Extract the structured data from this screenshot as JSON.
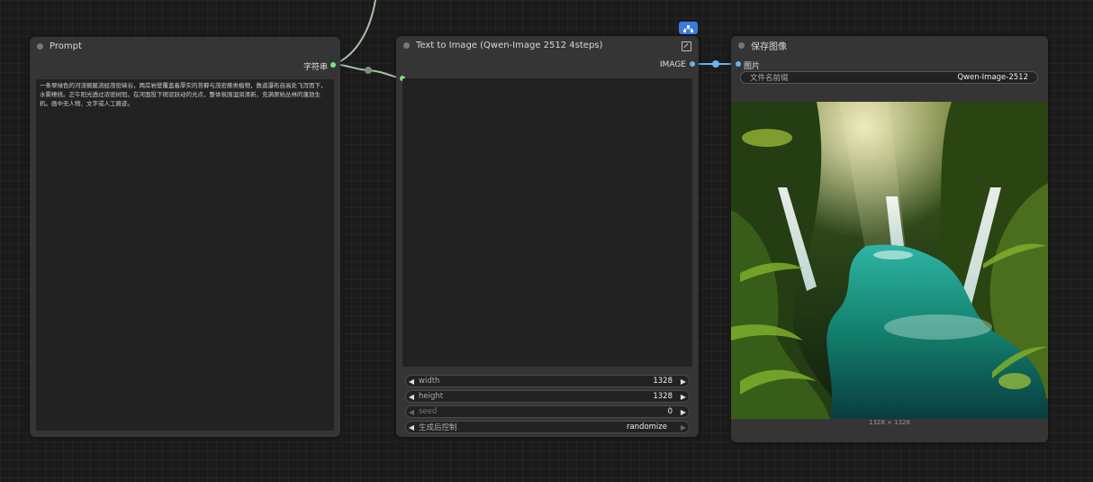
{
  "nodes": {
    "prompt": {
      "title": "Prompt",
      "output_label": "字符串",
      "text": "一条翠绿色的河流蜿蜒流经茂密峡谷，两岸岩壁覆盖着厚实的苔藓与茂密蕨类植物，数道瀑布自高处飞泻而下，水雾缭绕。正午阳光透过浓密树冠，在河面投下斑驳跃动的光点，整体氛围湿润清新，充满原始丛林的蓬勃生机。画中无人物、文字或人工痕迹。"
    },
    "t2i": {
      "title": "Text to Image (Qwen-Image 2512 4steps)",
      "output_label": "IMAGE",
      "widgets": [
        {
          "name": "width",
          "value": "1328"
        },
        {
          "name": "height",
          "value": "1328"
        },
        {
          "name": "seed",
          "value": "0"
        },
        {
          "name": "生成后控制",
          "value": "randomize"
        }
      ]
    },
    "save": {
      "title": "保存图像",
      "input_label": "图片",
      "filename_label": "文件名前缀",
      "filename_value": "Qwen-Image-2512",
      "image_caption": "1328 × 1328",
      "image_description": "waterfall-jungle-river"
    }
  },
  "colors": {
    "string_port": "#7fe07f",
    "image_port": "#64b5f6",
    "badge": "#3b7be0"
  },
  "icons": [
    "expand-icon",
    "subgraph-icon",
    "arrow-left-icon",
    "arrow-right-icon"
  ]
}
